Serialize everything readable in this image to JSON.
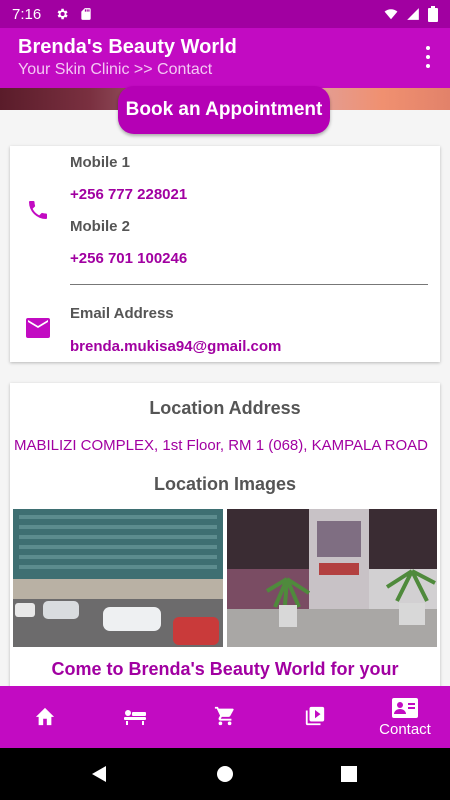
{
  "status_bar": {
    "time": "7:16"
  },
  "app_bar": {
    "title": "Brenda's Beauty World",
    "subtitle": "Your Skin Clinic >> Contact"
  },
  "book_button_label": "Book an Appointment",
  "contact": {
    "mobile1_label": "Mobile 1",
    "mobile1_value": "+256 777 228021",
    "mobile2_label": "Mobile 2",
    "mobile2_value": "+256 701 100246",
    "email_label": "Email Address",
    "email_value": "brenda.mukisa94@gmail.com"
  },
  "location": {
    "address_heading": "Location Address",
    "address": "MABILIZI COMPLEX, 1st Floor, RM 1 (068), KAMPALA ROAD",
    "images_heading": "Location Images",
    "promo": "Come to Brenda's Beauty World for your"
  },
  "bottom_nav": {
    "items": [
      {
        "icon": "home-icon",
        "label": ""
      },
      {
        "icon": "spa-icon",
        "label": ""
      },
      {
        "icon": "cart-icon",
        "label": ""
      },
      {
        "icon": "video-library-icon",
        "label": ""
      },
      {
        "icon": "contact-card-icon",
        "label": "Contact"
      }
    ]
  },
  "colors": {
    "primary": "#c20bc2",
    "dark": "#a100a1",
    "accent_text": "#a100a1"
  }
}
